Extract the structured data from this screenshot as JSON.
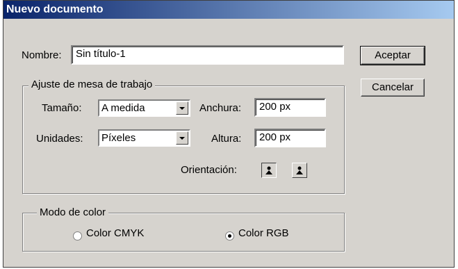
{
  "window": {
    "title": "Nuevo documento"
  },
  "name_field": {
    "label": "Nombre:",
    "value": "Sin título-1"
  },
  "buttons": {
    "ok": "Aceptar",
    "cancel": "Cancelar"
  },
  "artboard": {
    "legend": "Ajuste de mesa de trabajo",
    "size_label": "Tamaño:",
    "size_value": "A medida",
    "units_label": "Unidades:",
    "units_value": "Píxeles",
    "width_label": "Anchura:",
    "width_value": "200 px",
    "height_label": "Altura:",
    "height_value": "200 px",
    "orientation_label": "Orientación:"
  },
  "color_mode": {
    "legend": "Modo de color",
    "cmyk_label": "Color CMYK",
    "rgb_label": "Color RGB",
    "selected": "rgb"
  },
  "colors": {
    "titlebar_start": "#0a246a",
    "titlebar_end": "#a6caf0",
    "dialog_bg": "#d6d3ce"
  }
}
